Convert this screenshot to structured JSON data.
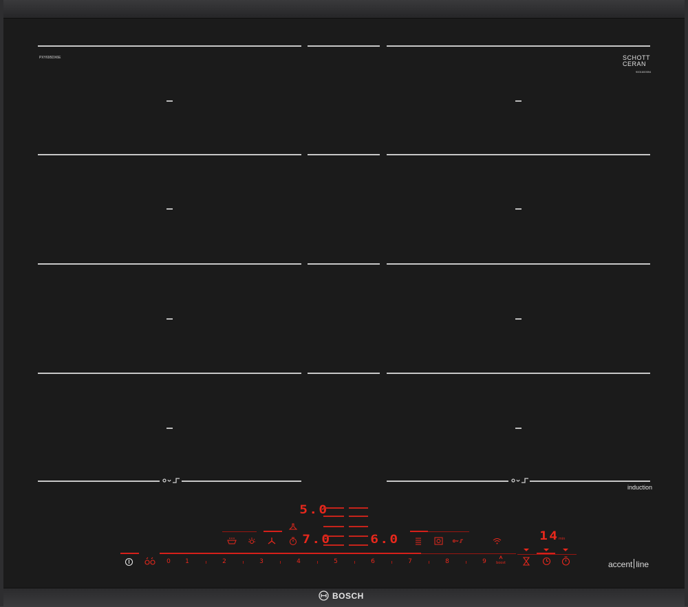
{
  "model_code": "PXY695DX6E",
  "glass_brand": {
    "line1": "SCHOTT",
    "line2": "CERAN",
    "serial": "9001600594"
  },
  "cooktop_type_label": "induction",
  "series_label": {
    "part1": "accent",
    "part2": "line"
  },
  "brand": "BOSCH",
  "zone_power_placeholder": "–",
  "displays": {
    "upper_setting": "5.0",
    "left_setting": "7.0",
    "right_setting": "6.0",
    "timer_value": "14",
    "timer_unit": "min"
  },
  "power_scale": [
    "0",
    "1",
    "2",
    "3",
    "4",
    "5",
    "6",
    "7",
    "8",
    "9"
  ],
  "boost_label": "boost",
  "icons": [
    "power-icon",
    "child-lock-icon",
    "move-mode-icon",
    "frying-sensor-icon",
    "hood-light-icon",
    "hood-fan-icon",
    "timer-icon",
    "hood-icon",
    "menu-icon",
    "cookit-icon",
    "flex-icon",
    "wifi-icon",
    "hourglass-icon",
    "countdown-icon",
    "stopwatch-icon"
  ],
  "colors": {
    "glass": "#1b1b1b",
    "display_red": "#e8281c",
    "marking_white": "#c9c9c9"
  }
}
